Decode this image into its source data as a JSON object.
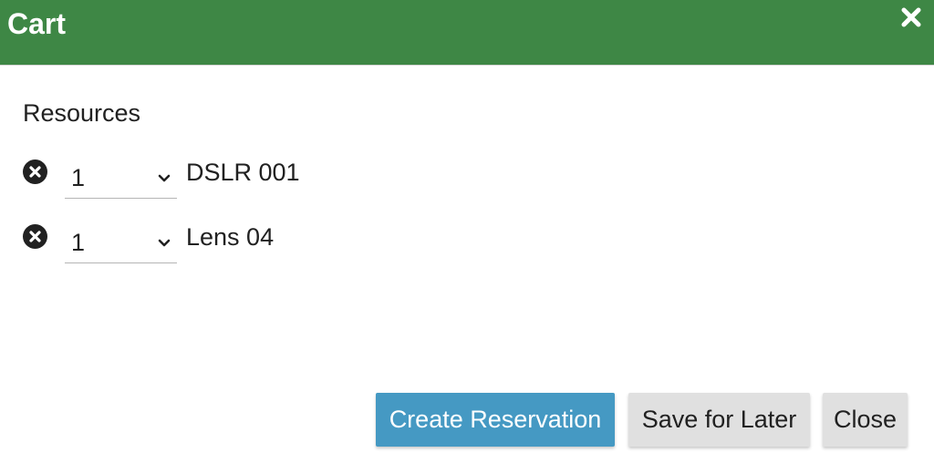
{
  "dialog": {
    "title": "Cart",
    "header_color": "#3e8745",
    "close_icon": "close-x-icon"
  },
  "resources": {
    "heading": "Resources",
    "items": [
      {
        "quantity": "1",
        "name": "DSLR 001"
      },
      {
        "quantity": "1",
        "name": "Lens 04"
      }
    ],
    "remove_icon": "remove-circle-icon",
    "dropdown_icon": "chevron-down-icon"
  },
  "footer": {
    "create_label": "Create Reservation",
    "save_label": "Save for Later",
    "close_label": "Close",
    "primary_color": "#4599c3",
    "secondary_color": "#e0e0e0"
  }
}
